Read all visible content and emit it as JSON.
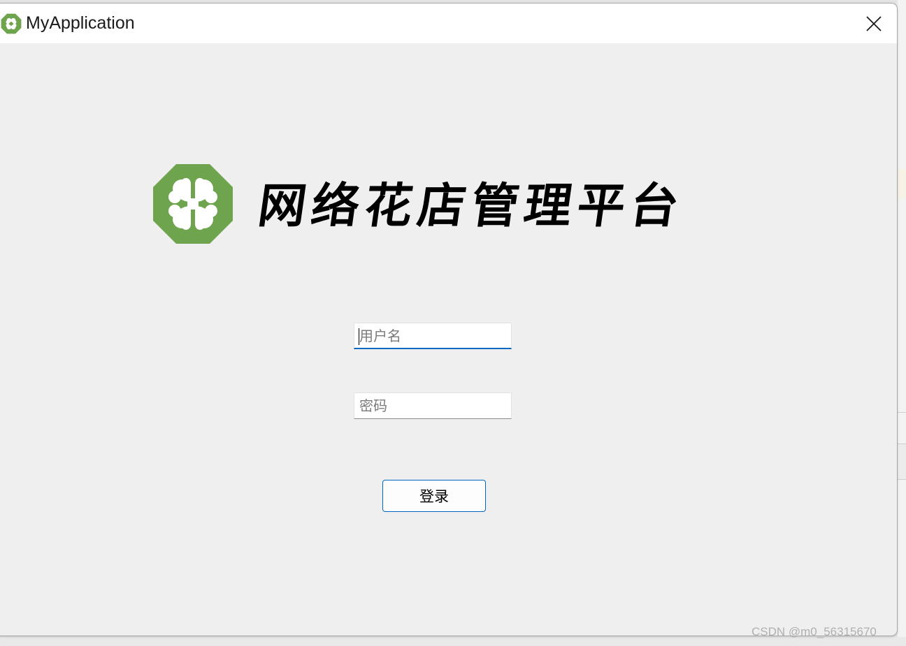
{
  "window": {
    "title": "MyApplication"
  },
  "brand": {
    "name": "网络花店管理平台",
    "logo_color": "#6fa44e"
  },
  "form": {
    "username": {
      "placeholder": "用户名",
      "value": ""
    },
    "password": {
      "placeholder": "密码",
      "value": ""
    },
    "login_label": "登录"
  },
  "watermark": "CSDN @m0_56315670",
  "colors": {
    "accent": "#0067c0",
    "window_bg": "#efefef"
  }
}
